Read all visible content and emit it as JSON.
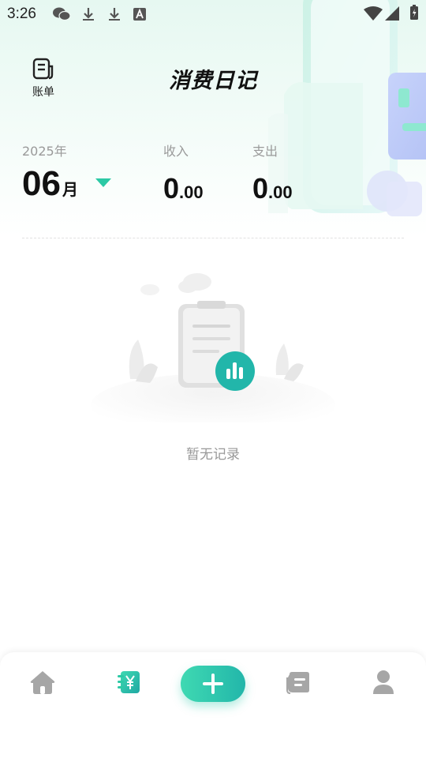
{
  "status_bar": {
    "time": "3:26",
    "left_icons": [
      "wechat-icon",
      "download-icon",
      "download-icon",
      "a-icon"
    ],
    "right_icons": [
      "wifi-icon",
      "signal-icon",
      "battery-icon"
    ]
  },
  "header": {
    "bill_label": "账单",
    "app_title": "消费日记"
  },
  "summary": {
    "year": "2025年",
    "month_number": "06",
    "month_unit": "月",
    "income_label": "收入",
    "income_int": "0",
    "income_dec": ".00",
    "expense_label": "支出",
    "expense_int": "0",
    "expense_dec": ".00"
  },
  "empty_state": {
    "text": "暂无记录"
  },
  "bottom_nav": {
    "items": [
      {
        "icon": "home-icon",
        "active": false
      },
      {
        "icon": "ledger-yen-icon",
        "active": true
      },
      {
        "icon": "add-icon",
        "active": false
      },
      {
        "icon": "notes-icon",
        "active": false
      },
      {
        "icon": "profile-icon",
        "active": false
      }
    ]
  },
  "colors": {
    "accent": "#2cc9a5",
    "accent_dark": "#22b6aa",
    "muted_text": "#999999",
    "icon_gray": "#a6a6a6"
  }
}
